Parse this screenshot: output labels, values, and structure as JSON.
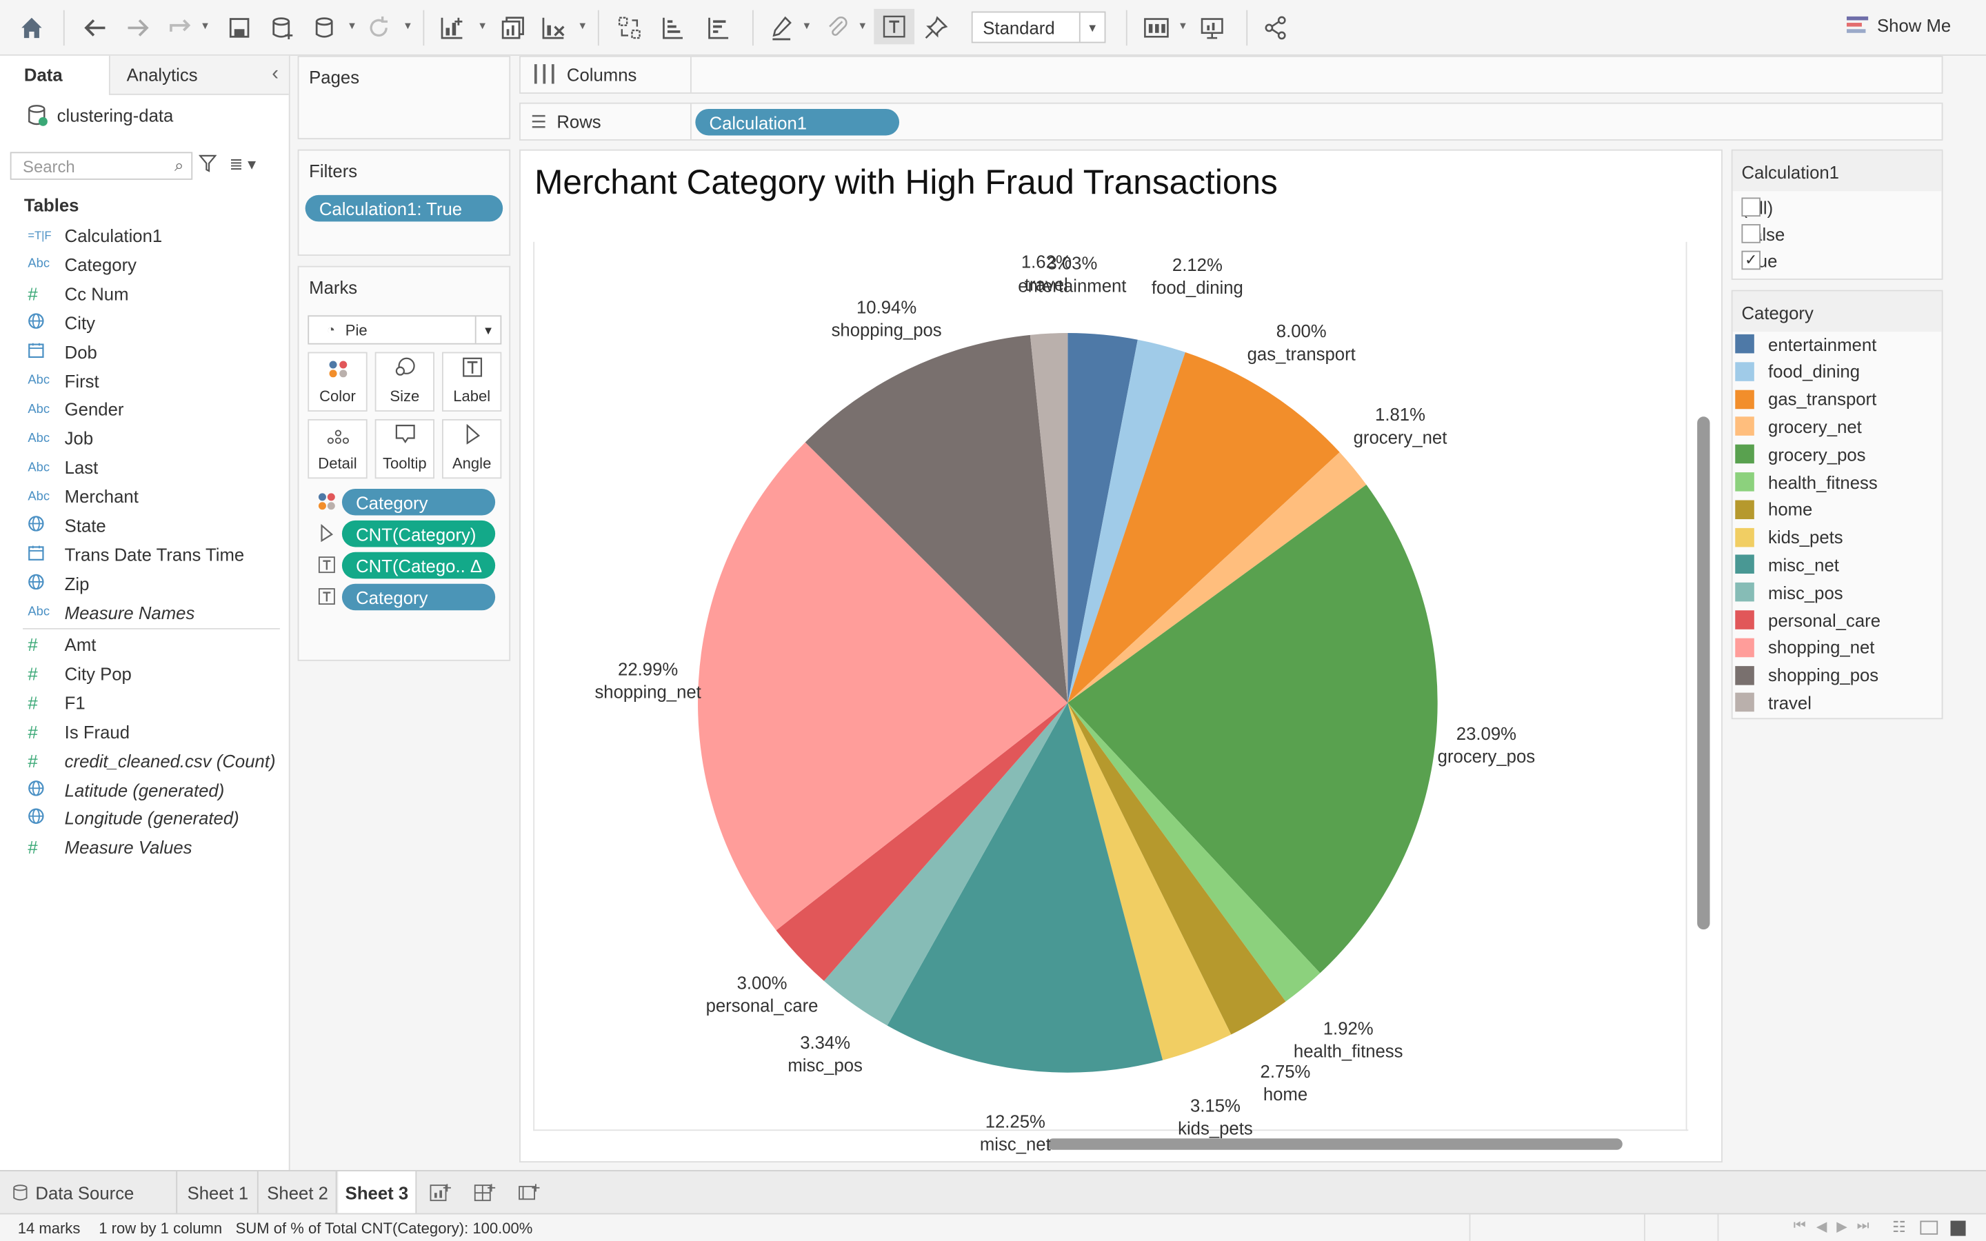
{
  "toolbar": {
    "mark_type_label": "Standard",
    "show_me": "Show Me"
  },
  "data_pane": {
    "tab_data": "Data",
    "tab_analytics": "Analytics",
    "datasource": "clustering-data",
    "search_placeholder": "Search",
    "tables_heading": "Tables",
    "fields": [
      {
        "icon": "=T|F",
        "label": "Calculation1"
      },
      {
        "icon": "Abc",
        "label": "Category"
      },
      {
        "icon": "#",
        "label": "Cc Num"
      },
      {
        "icon": "globe",
        "label": "City"
      },
      {
        "icon": "calendar",
        "label": "Dob"
      },
      {
        "icon": "Abc",
        "label": "First"
      },
      {
        "icon": "Abc",
        "label": "Gender"
      },
      {
        "icon": "Abc",
        "label": "Job"
      },
      {
        "icon": "Abc",
        "label": "Last"
      },
      {
        "icon": "Abc",
        "label": "Merchant"
      },
      {
        "icon": "globe",
        "label": "State"
      },
      {
        "icon": "calendar",
        "label": "Trans Date Trans Time"
      },
      {
        "icon": "globe",
        "label": "Zip"
      },
      {
        "icon": "Abc",
        "label": "Measure Names"
      }
    ],
    "measures": [
      {
        "icon": "#",
        "label": "Amt"
      },
      {
        "icon": "#",
        "label": "City Pop"
      },
      {
        "icon": "#",
        "label": "F1"
      },
      {
        "icon": "#",
        "label": "Is Fraud"
      },
      {
        "icon": "#",
        "label": "credit_cleaned.csv (Count)"
      },
      {
        "icon": "globe",
        "label": "Latitude (generated)"
      },
      {
        "icon": "globe",
        "label": "Longitude (generated)"
      },
      {
        "icon": "#",
        "label": "Measure Values"
      }
    ]
  },
  "cards": {
    "pages_title": "Pages",
    "filters_title": "Filters",
    "filter_pill": "Calculation1: True",
    "marks_title": "Marks",
    "mark_type": "Pie",
    "buttons": [
      "Color",
      "Size",
      "Label",
      "Detail",
      "Tooltip",
      "Angle"
    ],
    "mark_pills": [
      "Category",
      "CNT(Category)",
      "CNT(Catego.. Δ",
      "Category"
    ]
  },
  "shelves": {
    "columns_label": "Columns",
    "rows_label": "Rows",
    "rows_pill": "Calculation1"
  },
  "view": {
    "title": "Merchant Category with High Fraud Transactions"
  },
  "chart_data": {
    "type": "pie",
    "title": "Merchant Category with High Fraud Transactions",
    "slices": [
      {
        "label": "entertainment",
        "value": 3.03,
        "color": "#4e79a7"
      },
      {
        "label": "food_dining",
        "value": 2.12,
        "color": "#a0cbe8"
      },
      {
        "label": "gas_transport",
        "value": 8.0,
        "color": "#f28e2b"
      },
      {
        "label": "grocery_net",
        "value": 1.81,
        "color": "#ffbe7d"
      },
      {
        "label": "grocery_pos",
        "value": 23.09,
        "color": "#59a14f"
      },
      {
        "label": "health_fitness",
        "value": 1.92,
        "color": "#8cd17d"
      },
      {
        "label": "home",
        "value": 2.75,
        "color": "#b6992d"
      },
      {
        "label": "kids_pets",
        "value": 3.15,
        "color": "#f1ce63"
      },
      {
        "label": "misc_net",
        "value": 12.25,
        "color": "#499894"
      },
      {
        "label": "misc_pos",
        "value": 3.34,
        "color": "#86bcb6"
      },
      {
        "label": "personal_care",
        "value": 3.0,
        "color": "#e15759"
      },
      {
        "label": "shopping_net",
        "value": 22.99,
        "color": "#ff9d9a"
      },
      {
        "label": "shopping_pos",
        "value": 10.94,
        "color": "#79706e"
      },
      {
        "label": "travel",
        "value": 1.62,
        "color": "#bab0ac"
      }
    ],
    "value_format": "percent"
  },
  "legend_calc": {
    "title": "Calculation1",
    "items": [
      {
        "label": "(All)",
        "checked": false
      },
      {
        "label": "False",
        "checked": false
      },
      {
        "label": "True",
        "checked": true
      }
    ]
  },
  "legend_category": {
    "title": "Category"
  },
  "tabs": {
    "data_source": "Data Source",
    "sheets": [
      "Sheet 1",
      "Sheet 2",
      "Sheet 3"
    ]
  },
  "status": {
    "marks": "14 marks",
    "rows_cols": "1 row by 1 column",
    "sum": "SUM of % of Total CNT(Category): 100.00%"
  }
}
